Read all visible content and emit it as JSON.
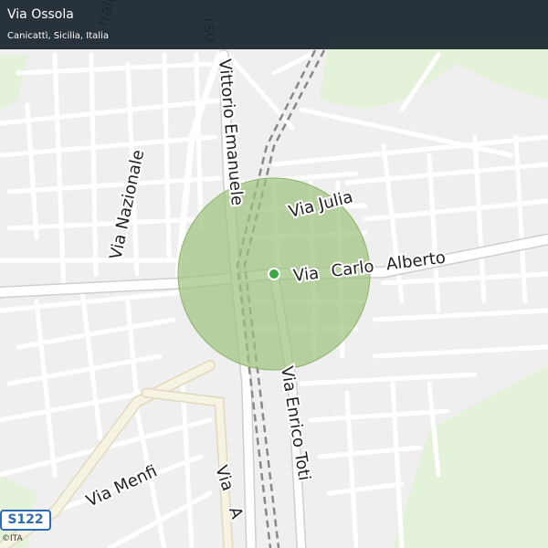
{
  "header": {
    "title": "Via Ossola",
    "subtitle": "Canicattì, Sicilia, Italia"
  },
  "map": {
    "street_labels": {
      "via_nazionale": "Via Nazionale",
      "corso_vittorio_emanuele": "Vittorio Emanuele",
      "via_julia": "Via Julia",
      "via_carlo_alberto": "Via Carlo Alberto",
      "via_enrico_toti": "Via Enrico Toti",
      "via_menfi": "Via Menfi",
      "via_a": "Via A",
      "corso_fragment": "rso",
      "nale_fragment": "nale"
    },
    "road_shield": "S122",
    "attribution": "©ITA",
    "colors": {
      "land": "#efefef",
      "road": "#ffffff",
      "road_casing": "#cfcfcf",
      "major_road": "#f7f3e3",
      "green_area": "#e5f2da",
      "highlight_circle": "#9ec27e",
      "marker": "#3aa645",
      "railway": "#888888"
    },
    "marker_icon": "location-dot-icon"
  }
}
